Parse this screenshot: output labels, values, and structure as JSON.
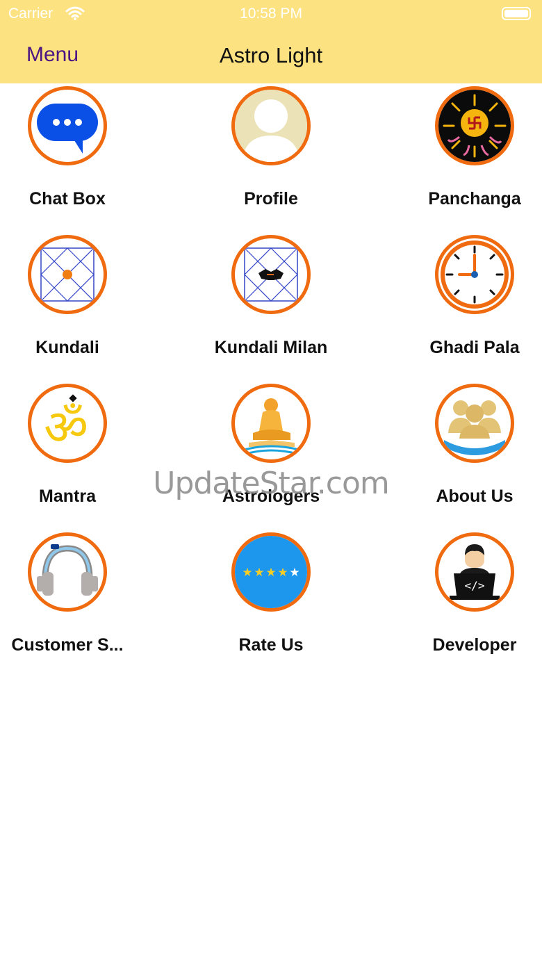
{
  "status_bar": {
    "carrier": "Carrier",
    "time": "10:58 PM",
    "wifi_icon": "wifi-icon",
    "battery_icon": "battery-icon"
  },
  "nav": {
    "menu_label": "Menu",
    "title": "Astro Light",
    "background": "#fce281",
    "menu_color": "#4b1684"
  },
  "grid": {
    "accent_ring": "#f06b0f",
    "items": [
      {
        "label": "Chat Box",
        "icon": "chat-bubble-icon"
      },
      {
        "label": "Profile",
        "icon": "user-avatar-icon"
      },
      {
        "label": "Panchanga",
        "icon": "sun-swastika-icon"
      },
      {
        "label": "Kundali",
        "icon": "kundali-chart-icon"
      },
      {
        "label": "Kundali Milan",
        "icon": "kundali-handshake-icon"
      },
      {
        "label": "Ghadi Pala",
        "icon": "clock-icon"
      },
      {
        "label": "Mantra",
        "icon": "om-icon"
      },
      {
        "label": "Astrologers",
        "icon": "sage-icon"
      },
      {
        "label": "About Us",
        "icon": "group-icon"
      },
      {
        "label": "Customer S...",
        "icon": "headphones-icon"
      },
      {
        "label": "Rate Us",
        "icon": "stars-icon"
      },
      {
        "label": "Developer",
        "icon": "developer-laptop-icon"
      }
    ]
  },
  "watermark": "UpdateStar.com"
}
